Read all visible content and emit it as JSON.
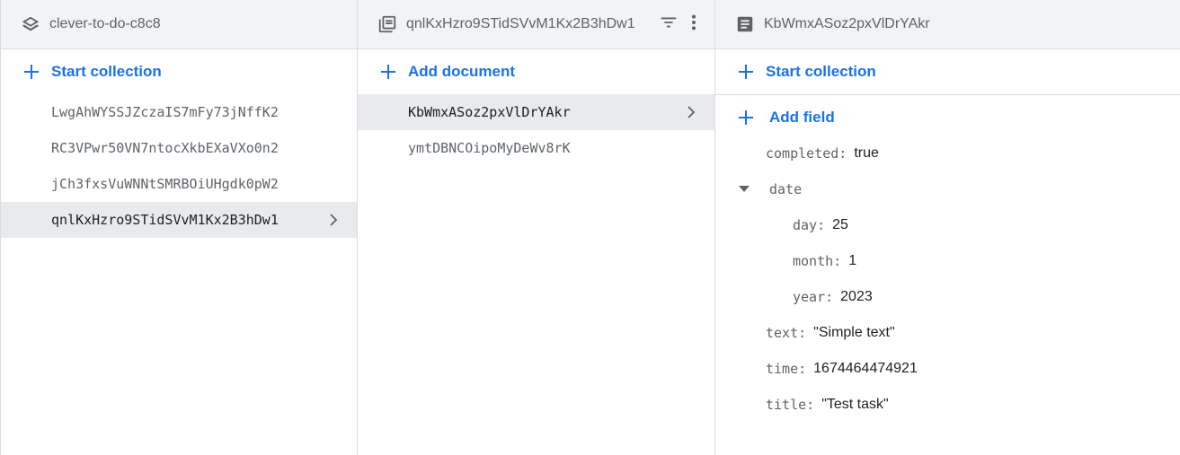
{
  "colors": {
    "accent": "#1a73e8",
    "header_bg": "#f1f3f4",
    "selected_bg": "#e8eaed",
    "border": "#dadce0"
  },
  "root": {
    "icon": "layers-icon",
    "title": "clever-to-do-c8c8",
    "start_collection_label": "Start collection",
    "collections": [
      {
        "id": "LwgAhWYSSJZczaIS7mFy73jNffK2",
        "selected": false
      },
      {
        "id": "RC3VPwr50VN7ntocXkbEXaVXo0n2",
        "selected": false
      },
      {
        "id": "jCh3fxsVuWNNtSMRBOiUHgdk0pW2",
        "selected": false
      },
      {
        "id": "qnlKxHzro9STidSVvM1Kx2B3hDw1",
        "selected": true
      }
    ]
  },
  "collection": {
    "icon": "collection-icon",
    "title": "qnlKxHzro9STidSVvM1Kx2B3hDw1",
    "add_document_label": "Add document",
    "documents": [
      {
        "id": "KbWmxASoz2pxVlDrYAkr",
        "selected": true
      },
      {
        "id": "ymtDBNCOipoMyDeWv8rK",
        "selected": false
      }
    ]
  },
  "document": {
    "icon": "document-icon",
    "title": "KbWmxASoz2pxVlDrYAkr",
    "start_collection_label": "Start collection",
    "add_field_label": "Add field",
    "fields": [
      {
        "key": "completed",
        "value": "true"
      },
      {
        "key": "date",
        "map": true,
        "expanded": true,
        "children": [
          {
            "key": "day",
            "value": "25"
          },
          {
            "key": "month",
            "value": "1"
          },
          {
            "key": "year",
            "value": "2023"
          }
        ]
      },
      {
        "key": "text",
        "value": "\"Simple text\""
      },
      {
        "key": "time",
        "value": "1674464474921"
      },
      {
        "key": "title",
        "value": "\"Test task\""
      }
    ]
  }
}
